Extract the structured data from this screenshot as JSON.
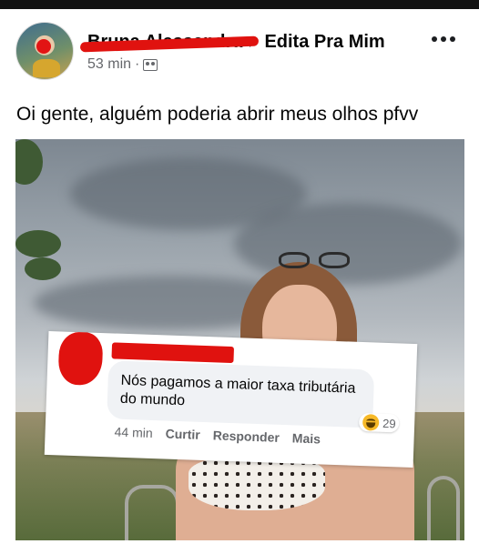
{
  "post": {
    "author_name": "Bruna Alessandra",
    "group_name": "Edita Pra Mim",
    "time": "53 min",
    "time_separator": "·",
    "audience_icon": "group-audience-icon",
    "text": "Oi gente, alguém poderia abrir meus olhos pfvv"
  },
  "comment": {
    "text": "Nós pagamos a maior taxa tributária do mundo",
    "time": "44 min",
    "curtir": "Curtir",
    "responder": "Responder",
    "mais": "Mais",
    "reaction_icon": "haha-icon",
    "reaction_count": "29"
  },
  "colors": {
    "redaction": "#e0120f",
    "meta_text": "#65676b",
    "bubble_bg": "#f0f2f5"
  }
}
